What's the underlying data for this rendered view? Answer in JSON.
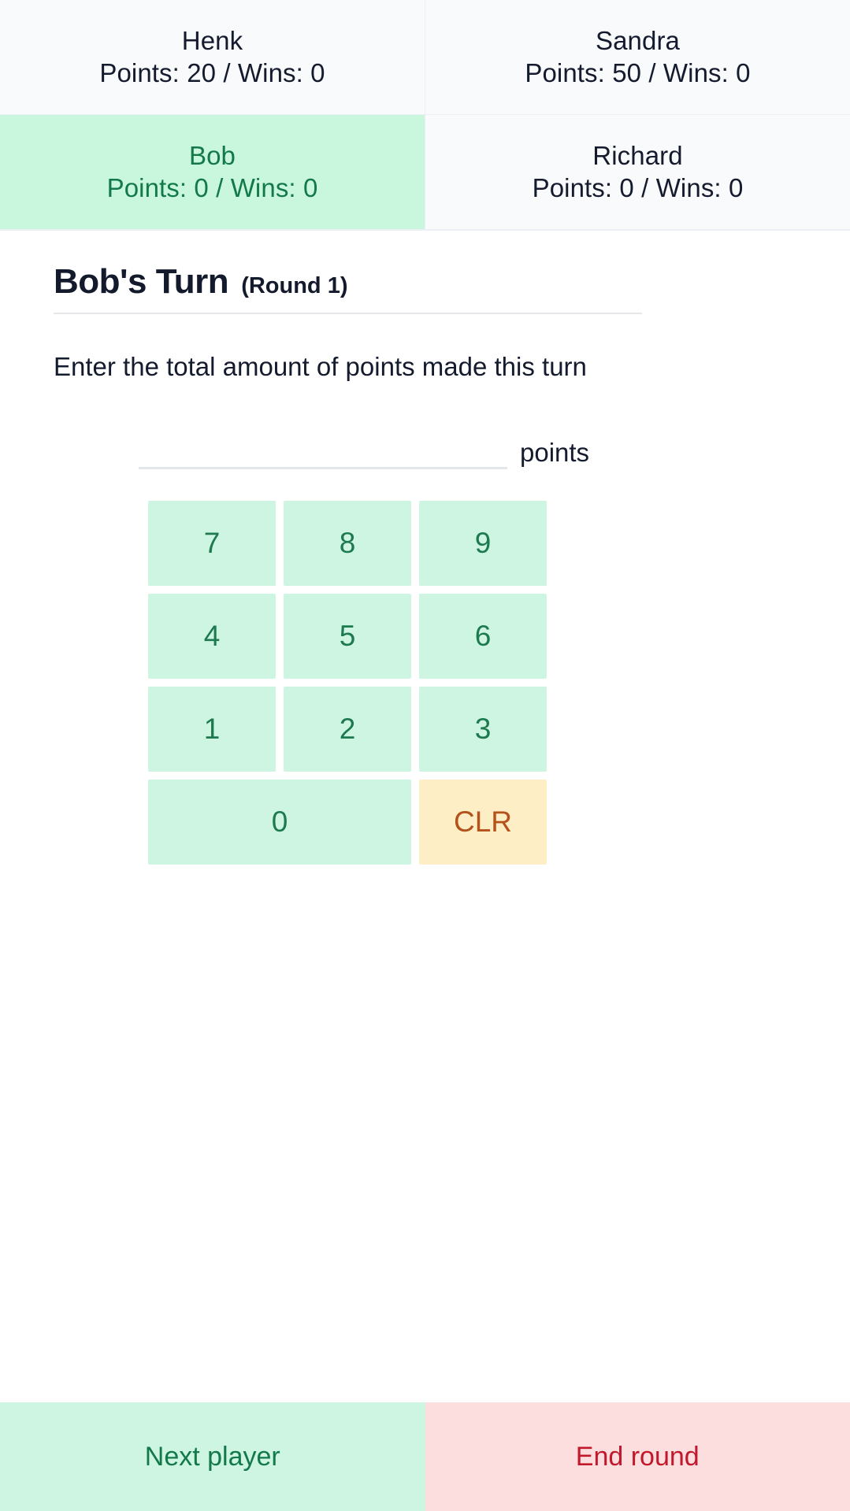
{
  "scoreboard": {
    "players": [
      {
        "name": "Henk",
        "stats": "Points: 20 / Wins: 0",
        "active": false
      },
      {
        "name": "Sandra",
        "stats": "Points: 50 / Wins: 0",
        "active": false
      },
      {
        "name": "Bob",
        "stats": "Points: 0 / Wins: 0",
        "active": true
      },
      {
        "name": "Richard",
        "stats": "Points: 0 / Wins: 0",
        "active": false
      }
    ]
  },
  "turn": {
    "title": "Bob's Turn",
    "round": "(Round 1)",
    "instruction": "Enter the total amount of points made this turn"
  },
  "input": {
    "value": "",
    "placeholder": "",
    "unit": "points"
  },
  "keypad": {
    "keys": [
      {
        "label": "7",
        "type": "digit"
      },
      {
        "label": "8",
        "type": "digit"
      },
      {
        "label": "9",
        "type": "digit"
      },
      {
        "label": "4",
        "type": "digit"
      },
      {
        "label": "5",
        "type": "digit"
      },
      {
        "label": "6",
        "type": "digit"
      },
      {
        "label": "1",
        "type": "digit"
      },
      {
        "label": "2",
        "type": "digit"
      },
      {
        "label": "3",
        "type": "digit"
      },
      {
        "label": "0",
        "type": "digit-wide"
      },
      {
        "label": "CLR",
        "type": "clear"
      }
    ]
  },
  "footer": {
    "next_label": "Next player",
    "end_label": "End round"
  },
  "colors": {
    "active_player_bg": "#c9f7dd",
    "active_player_text": "#13794a",
    "key_bg": "#cdf5e1",
    "key_text": "#1d7a4f",
    "clear_bg": "#fdeec5",
    "clear_text": "#b4521b",
    "next_bg": "#cdf5e1",
    "next_text": "#13794a",
    "end_bg": "#fcdede",
    "end_text": "#c2182c",
    "card_bg": "#f9fafb",
    "heading_text": "#131a2c"
  }
}
